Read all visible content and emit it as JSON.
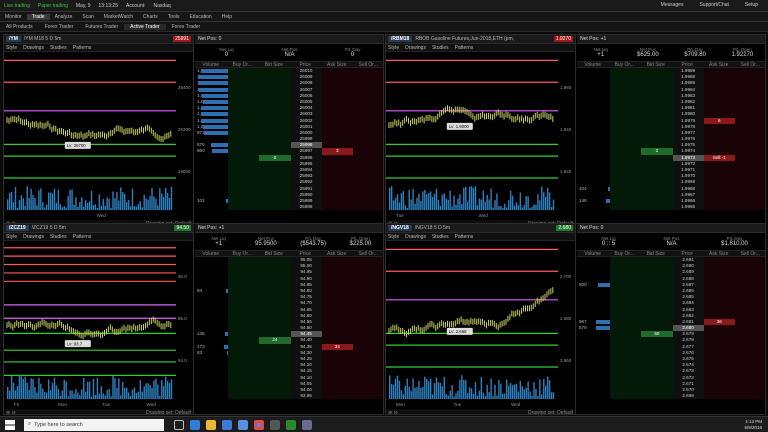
{
  "topbar": {
    "left": [
      "Live trading",
      "Paper trading",
      "May, 9",
      "13:13:25",
      "Account:",
      "Nasdaq"
    ],
    "right": [
      "Messages",
      "Support/Chat",
      "Setup"
    ]
  },
  "menu": [
    "Monitor",
    "Trade",
    "Analyze",
    "Scan",
    "MarketWatch",
    "Charts",
    "Tools",
    "Education",
    "Help"
  ],
  "subtabs": [
    "All Products",
    "Forex Trader",
    "Futures Trader",
    "Active Trader",
    "Forex Trader"
  ],
  "panels": [
    {
      "id": "ym",
      "sym": "/YM",
      "title": "/YM M18 5 D 5m",
      "last": "25991",
      "lastClass": "",
      "hover": "Lv: 26700",
      "period": "Wed",
      "ladTitle": "Net Pos: 0",
      "stats": [
        [
          "Net Liq",
          "0"
        ],
        [
          "Net Pos",
          "N/A"
        ],
        [
          "P/L Day",
          "0"
        ]
      ],
      "cur": 12,
      "prices": [
        "26010",
        "26009",
        "26008",
        "26007",
        "26006",
        "26005",
        "26004",
        "26003",
        "26002",
        "26001",
        "26000",
        "25999",
        "25998",
        "25997",
        "25996",
        "25995",
        "25994",
        "25993",
        "25992",
        "25991",
        "25990",
        "25989",
        "25988"
      ],
      "vols": [
        "1,070",
        "1,359",
        "1,345",
        "1,159",
        "1,065",
        "1,025",
        "1,070",
        "1,101",
        "1,082",
        "1,014",
        "973",
        "",
        "676",
        "660",
        "",
        "",
        "",
        "",
        "",
        "",
        "",
        "101",
        ""
      ],
      "bids": {
        "14": "0"
      },
      "asks": {
        "13": "3"
      },
      "days": [
        "",
        "Wed"
      ],
      "ylabels": [
        "26400",
        "26200",
        "26000"
      ]
    },
    {
      "id": "rb",
      "sym": "/RBM18",
      "title": "RBOB Gasoline Futures,Jun-2018,ETH (pm,",
      "last": "1.9270",
      "lastClass": "",
      "hover": "Lv: 1.9000",
      "period": "Wed",
      "ladTitle": "Net Pos: +1",
      "stats": [
        [
          "Net Liq",
          "+1"
        ],
        [
          "Net Pos",
          "$625.00"
        ],
        [
          "P/L Day",
          "$709.80"
        ],
        [
          "P/L Open",
          "1.92270"
        ]
      ],
      "cur": 14,
      "prices": [
        "1.9989",
        "1.9988",
        "1.9985",
        "1.9984",
        "1.9983",
        "1.9982",
        "1.9981",
        "1.9980",
        "1.9979",
        "1.9978",
        "1.9977",
        "1.9976",
        "1.9975",
        "1.9974",
        "1.9973",
        "1.9972",
        "1.9971",
        "1.9970",
        "1.9969",
        "1.9968",
        "1.9967",
        "1.9966",
        "1.9965"
      ],
      "vols": [
        "",
        "",
        "",
        "",
        "",
        "",
        "",
        "",
        "",
        "",
        "",
        "",
        "",
        "",
        "",
        "",
        "",
        "",
        "",
        "104",
        "",
        "148",
        ""
      ],
      "bids": {
        "13": "2"
      },
      "asks": {
        "8": "6",
        "14": "Sell -1"
      },
      "days": [
        "Tue",
        "Wed"
      ],
      "ylabels": [
        "1.960",
        "1.940",
        "1.920"
      ]
    },
    {
      "id": "zc",
      "sym": "/ZCZ19",
      "title": "/ZCZ19 5 D 5m",
      "last": "94.50",
      "lastClass": "g",
      "hover": "Lv: 93.7",
      "period": "Wed",
      "ladTitle": "Net Pos: +1",
      "stats": [
        [
          "Net Liq",
          "+1"
        ],
        [
          "Net Pos",
          "95.9500"
        ],
        [
          "P/L Day",
          "($543.75)"
        ],
        [
          "P/L Open",
          "$225.00"
        ]
      ],
      "cur": 12,
      "prices": [
        "95.05",
        "95.00",
        "94.95",
        "94.90",
        "94.85",
        "94.80",
        "94.75",
        "94.70",
        "94.65",
        "94.60",
        "94.55",
        "94.50",
        "94.45",
        "94.40",
        "94.35",
        "94.30",
        "94.25",
        "94.20",
        "94.15",
        "94.10",
        "94.05",
        "94.00",
        "93.95"
      ],
      "vols": [
        "",
        "",
        "",
        "",
        "",
        "94",
        "",
        "",
        "",
        "",
        "",
        "",
        "145",
        "",
        "173",
        "63",
        "",
        "",
        "",
        "",
        "",
        "",
        ""
      ],
      "bids": {
        "13": "24"
      },
      "asks": {
        "14": "34"
      },
      "days": [
        "Fri",
        "Mon",
        "Tue",
        "Wed"
      ],
      "ylabels": [
        "96.0",
        "95.0",
        "94.0"
      ]
    },
    {
      "id": "ng",
      "sym": "/NGV18",
      "title": "/NGV18 5 D 5m",
      "last": "2.680",
      "lastClass": "g",
      "hover": "Lv: 2.668",
      "period": "Wed",
      "ladTitle": "Net Pos: 0",
      "stats": [
        [
          "Net Liq",
          "0 :: 5"
        ],
        [
          "Net Pos",
          "N/A"
        ],
        [
          "P/L Day",
          "$1,810.00"
        ]
      ],
      "cur": 11,
      "prices": [
        "2.691",
        "2.690",
        "2.689",
        "2.688",
        "2.687",
        "2.686",
        "2.685",
        "2.684",
        "2.683",
        "2.682",
        "2.681",
        "2.680",
        "2.679",
        "2.678",
        "2.677",
        "2.676",
        "2.675",
        "2.674",
        "2.673",
        "2.672",
        "2.671",
        "2.670",
        "2.669"
      ],
      "vols": [
        "",
        "",
        "",
        "",
        "500",
        "",
        "",
        "",
        "",
        "",
        "567",
        "576",
        "",
        "",
        "",
        "",
        "",
        "",
        "",
        "",
        "",
        "",
        ""
      ],
      "bids": {
        "12": "60"
      },
      "asks": {
        "10": "36"
      },
      "days": [
        "Mon",
        "Tue",
        "Wed"
      ],
      "ylabels": [
        "2.700",
        "2.680",
        "2.660"
      ]
    }
  ],
  "chartUi": {
    "style": "Style",
    "drawings": "Drawings",
    "studies": "Studies",
    "patterns": "Patterns",
    "drawingSet": "Drawing set: Default",
    "volume": "Volume"
  },
  "ladderCols": [
    "Volume",
    "Buy Or...",
    "Bid Size",
    "Price",
    "Ask Size",
    "Sell Or..."
  ],
  "taskbar": {
    "search": "Type here to search",
    "time": "1:13 PM",
    "date": "5/9/2018"
  },
  "colors": {
    "red": "#ff5a5a",
    "magenta": "#e060ff",
    "green": "#30d030",
    "candle": "#c8d060",
    "volume": "#2d80c0"
  }
}
